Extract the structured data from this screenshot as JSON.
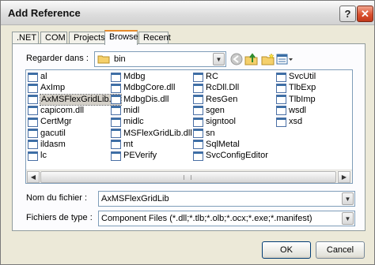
{
  "window": {
    "title": "Add Reference",
    "help_glyph": "?",
    "close_glyph": "✕"
  },
  "tabs": [
    ".NET",
    "COM",
    "Projects",
    "Browse",
    "Recent"
  ],
  "active_tab": "Browse",
  "look_in": {
    "label": "Regarder dans :",
    "value": "bin"
  },
  "file_columns": [
    [
      "al",
      "AxImp",
      "AxMSFlexGridLib.dll",
      "capicom.dll",
      "CertMgr",
      "gacutil",
      "ildasm",
      "lc"
    ],
    [
      "Mdbg",
      "MdbgCore.dll",
      "MdbgDis.dll",
      "midl",
      "midlc",
      "MSFlexGridLib.dll",
      "mt",
      "PEVerify"
    ],
    [
      "RC",
      "RcDll.Dll",
      "ResGen",
      "sgen",
      "signtool",
      "sn",
      "SqlMetal",
      "SvcConfigEditor"
    ],
    [
      "SvcUtil",
      "TlbExp",
      "TlbImp",
      "wsdl",
      "xsd"
    ]
  ],
  "selected_file": "AxMSFlexGridLib.dll",
  "file_name": {
    "label": "Nom du fichier :",
    "value": "AxMSFlexGridLib"
  },
  "file_type": {
    "label": "Fichiers de type :",
    "value": "Component Files (*.dll;*.tlb;*.olb;*.ocx;*.exe;*.manifest)"
  },
  "buttons": {
    "ok": "OK",
    "cancel": "Cancel"
  }
}
